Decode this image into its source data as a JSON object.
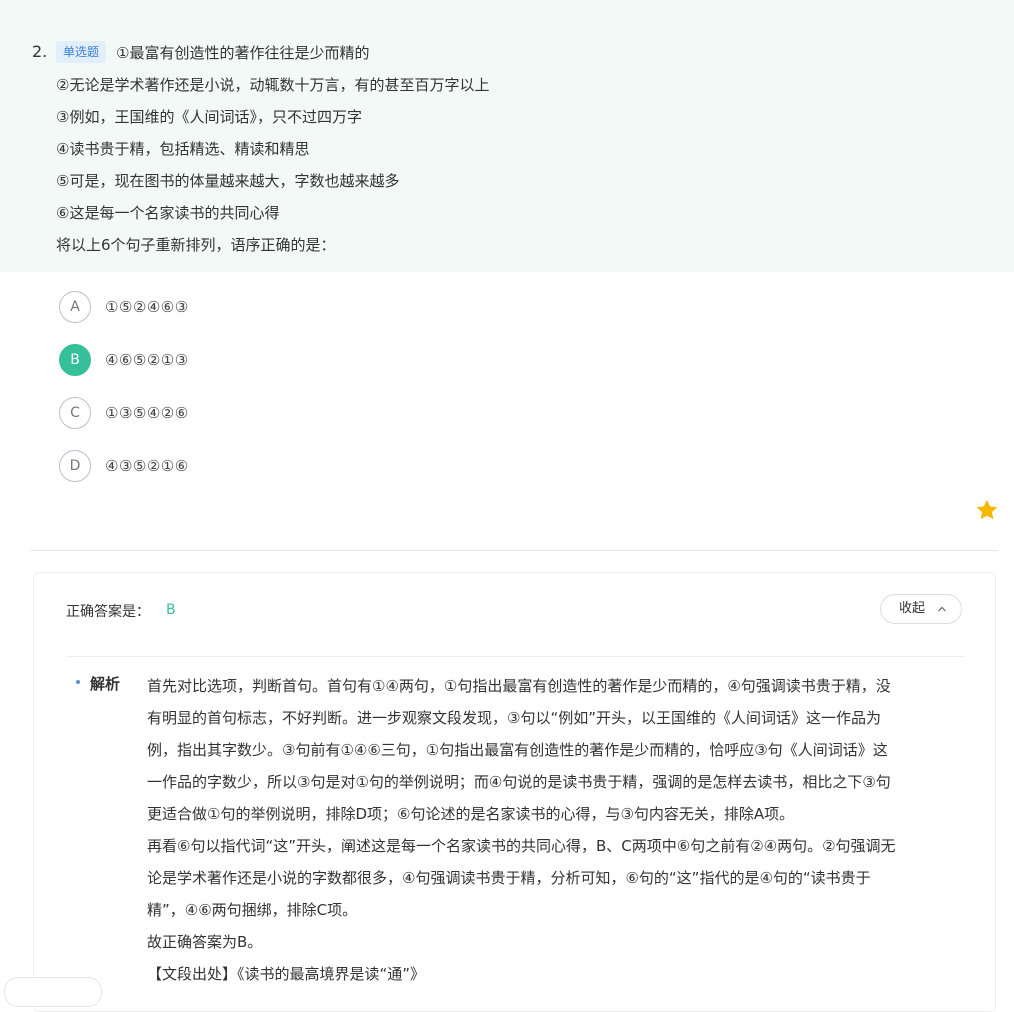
{
  "question": {
    "number": "2.",
    "type_badge": "单选题",
    "lines": [
      "①最富有创造性的著作往往是少而精的",
      "②无论是学术著作还是小说，动辄数十万言，有的甚至百万字以上",
      "③例如，王国维的《人间词话》，只不过四万字",
      "④读书贵于精，包括精选、精读和精思",
      "⑤可是，现在图书的体量越来越大，字数也越来越多",
      "⑥这是每一个名家读书的共同心得",
      "将以上6个句子重新排列，语序正确的是："
    ]
  },
  "options": [
    {
      "letter": "A",
      "text": "①⑤②④⑥③",
      "selected": false
    },
    {
      "letter": "B",
      "text": "④⑥⑤②①③",
      "selected": true
    },
    {
      "letter": "C",
      "text": "①③⑤④②⑥",
      "selected": false
    },
    {
      "letter": "D",
      "text": "④③⑤②①⑥",
      "selected": false
    }
  ],
  "favorite_icon": "star-icon",
  "answer": {
    "label": "正确答案是：",
    "value": "B",
    "collapse_label": "收起",
    "collapse_icon": "chevron-up-icon"
  },
  "analysis": {
    "label": "解析",
    "lines": [
      "首先对比选项，判断首句。首句有①④两句，①句指出最富有创造性的著作是少而精的，④句强调读书贵于精，没",
      "有明显的首句标志，不好判断。进一步观察文段发现，③句以“例如”开头，以王国维的《人间词话》这一作品为",
      "例，指出其字数少。③句前有①④⑥三句，①句指出最富有创造性的著作是少而精的，恰呼应③句《人间词话》这",
      "一作品的字数少，所以③句是对①句的举例说明；而④句说的是读书贵于精，强调的是怎样去读书，相比之下③句",
      "更适合做①句的举例说明，排除D项；⑥句论述的是名家读书的心得，与③句内容无关，排除A项。",
      "再看⑥句以指代词“这”开头，阐述这是每一个名家读书的共同心得，B、C两项中⑥句之前有②④两句。②句强调无",
      "论是学术著作还是小说的字数都很多，④句强调读书贵于精，分析可知，⑥句的“这”指代的是④句的“读书贵于",
      "精”，④⑥两句捆绑，排除C项。",
      "故正确答案为B。",
      "【文段出处】《读书的最高境界是读“通”》"
    ]
  },
  "colors": {
    "accent": "#35c09a",
    "question_bg": "#f3f9f7",
    "badge_text": "#3a7fd5",
    "star": "#f5b800"
  }
}
